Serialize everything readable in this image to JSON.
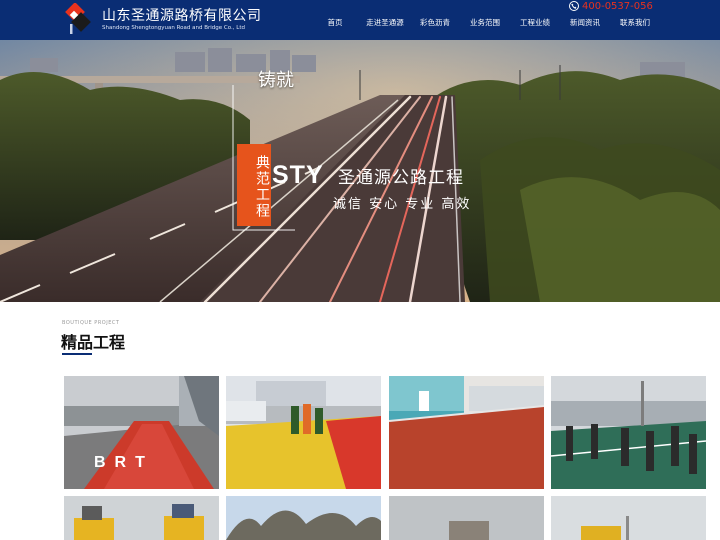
{
  "header": {
    "company_cn": "山东圣通源路桥有限公司",
    "company_en": "Shandong Shengtongyuan Road and Bridge Co., Ltd",
    "phone": "400-0537-056",
    "nav": [
      {
        "label": "首页"
      },
      {
        "label": "走进圣通源"
      },
      {
        "label": "彩色沥青"
      },
      {
        "label": "业务范围"
      },
      {
        "label": "工程业绩"
      },
      {
        "label": "新闻资讯"
      },
      {
        "label": "联系我们"
      }
    ]
  },
  "hero": {
    "calligraphy": "铸就",
    "seal": "典范工程",
    "brand": "STY",
    "title": "圣通源公路工程",
    "slogan": "诚信 安心 专业 高效"
  },
  "section": {
    "subtitle_en": "BOUTIQUE PROJECT",
    "title": "精品工程",
    "cards": [
      {
        "caption": "BRT"
      },
      {
        "caption": ""
      },
      {
        "caption": ""
      },
      {
        "caption": ""
      },
      {
        "caption": ""
      },
      {
        "caption": ""
      },
      {
        "caption": ""
      },
      {
        "caption": ""
      }
    ]
  },
  "colors": {
    "header_bg": "#0a2d74",
    "accent_red": "#e8321e",
    "seal_orange": "#e6541c"
  },
  "icons": [
    "logo-mark-icon",
    "phone-icon"
  ]
}
